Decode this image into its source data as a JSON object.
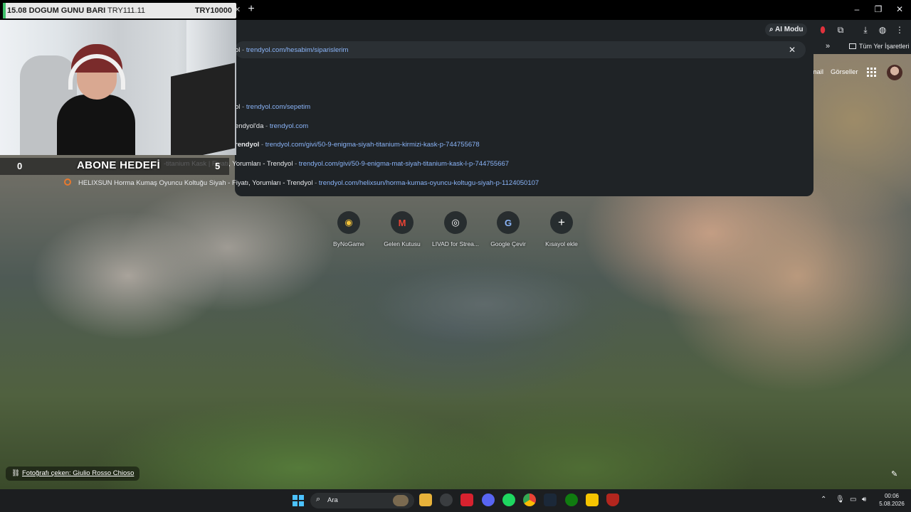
{
  "overlay": {
    "donation_title": "15.08 DOGUM GUNU BARI",
    "donation_current": "TRY111.11",
    "donation_goal": "TRY10000",
    "donation_progress": 0.0111,
    "sub_goal_title": "ABONE HEDEFİ",
    "sub_goal_current": "0",
    "sub_goal_target": "5"
  },
  "browser": {
    "new_tab": "+",
    "ai_mode": "AI Modu",
    "all_bookmarks": "Tüm Yer İşaretleri",
    "bookmarks_more": "»",
    "window_controls": [
      "–",
      "❐",
      "✕"
    ]
  },
  "omnibox": {
    "rows": [
      {
        "prefix": "ol",
        "sep": " - ",
        "url": "trendyol.com/hesabim/siparislerim"
      },
      {
        "prefix": "ol",
        "sep": " - ",
        "url": "trendyol.com/sepetim"
      },
      {
        "prefix": "endyol'da",
        "sep": " - ",
        "url": "trendyol.com"
      },
      {
        "prefix": "rendyol",
        "sep": " - ",
        "url": "trendyol.com/givi/50-9-enigma-siyah-titanium-kirmizi-kask-p-744755678"
      },
      {
        "prefix": "-titanium Kask | Fiyatı, Yorumları - Trendyol",
        "sep": " - ",
        "url": "trendyol.com/givi/50-9-enigma-mat-siyah-titanium-kask-l-p-744755667"
      },
      {
        "prefix": "HELIXSUN Horma Kumaş Oyuncu Koltuğu Siyah - Fiyatı, Yorumları - Trendyol",
        "sep": " - ",
        "url": "trendyol.com/helixsun/horma-kumas-oyuncu-koltugu-siyah-p-1124050107"
      }
    ],
    "clear": "✕"
  },
  "google": {
    "gmail": "Gmail",
    "images": "Görseller"
  },
  "shortcuts": [
    {
      "label": "ByNoGame",
      "icon": "bynogame-icon",
      "glyph": "◉"
    },
    {
      "label": "Gelen Kutusu",
      "icon": "gmail-icon",
      "glyph": "M"
    },
    {
      "label": "LIVAD for Strea...",
      "icon": "livad-icon",
      "glyph": "◎"
    },
    {
      "label": "Google Çevir",
      "icon": "google-translate-icon",
      "glyph": "G"
    },
    {
      "label": "Kısayol ekle",
      "icon": "add-icon",
      "glyph": "+"
    }
  ],
  "credit": "Fotoğrafı çeken: Giulio Rosso Chioso",
  "taskbar": {
    "search_placeholder": "Ara",
    "time": "00:06",
    "date": "5.08.2026"
  },
  "colors": {
    "accent": "#8ab4f8",
    "donation_fill": "#3ec06a",
    "windows_blue": "#4cc2ff"
  }
}
